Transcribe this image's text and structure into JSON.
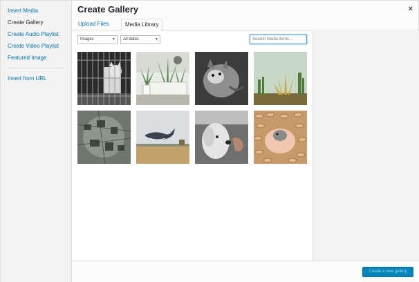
{
  "menu": {
    "items": [
      {
        "label": "Insert Media"
      },
      {
        "label": "Create Gallery"
      },
      {
        "label": "Create Audio Playlist"
      },
      {
        "label": "Create Video Playlist"
      },
      {
        "label": "Featured Image"
      }
    ],
    "url_item": "Insert from URL"
  },
  "header": {
    "title": "Create Gallery",
    "close": "×"
  },
  "tabs": [
    {
      "label": "Upload Files"
    },
    {
      "label": "Media Library"
    }
  ],
  "toolbar": {
    "type_filter": "Images",
    "date_filter": "All dates",
    "search_placeholder": "Search media items..."
  },
  "attachments": [
    {
      "name": "cat-in-cage"
    },
    {
      "name": "succulents-planter"
    },
    {
      "name": "cat-lying"
    },
    {
      "name": "cactus-sky"
    },
    {
      "name": "metal-pattern"
    },
    {
      "name": "whale-field"
    },
    {
      "name": "dog-hand"
    },
    {
      "name": "hamster-peanuts"
    }
  ],
  "footer": {
    "button": "Create a new gallery"
  },
  "colors": {
    "accent": "#0085ba",
    "link": "#0073aa"
  }
}
